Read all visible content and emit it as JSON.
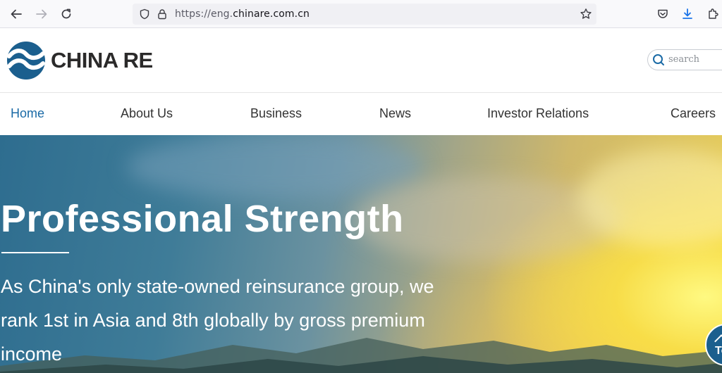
{
  "browser": {
    "url_prefix": "https://eng.",
    "url_domain": "chinare.com.cn"
  },
  "header": {
    "logo_text": "CHINA RE",
    "search_placeholder": "search"
  },
  "nav": {
    "items": [
      {
        "label": "Home",
        "active": true
      },
      {
        "label": "About Us"
      },
      {
        "label": "Business"
      },
      {
        "label": "News"
      },
      {
        "label": "Investor Relations"
      },
      {
        "label": "Careers"
      }
    ]
  },
  "hero": {
    "title": "Professional Strength",
    "text": "As China's only state-owned reinsurance group, we rank 1st in Asia and 8th globally by gross premium income"
  },
  "back_to_top": {
    "label": "To"
  },
  "colors": {
    "accent": "#1a6aa6",
    "logo_blue": "#1b5f8e"
  }
}
